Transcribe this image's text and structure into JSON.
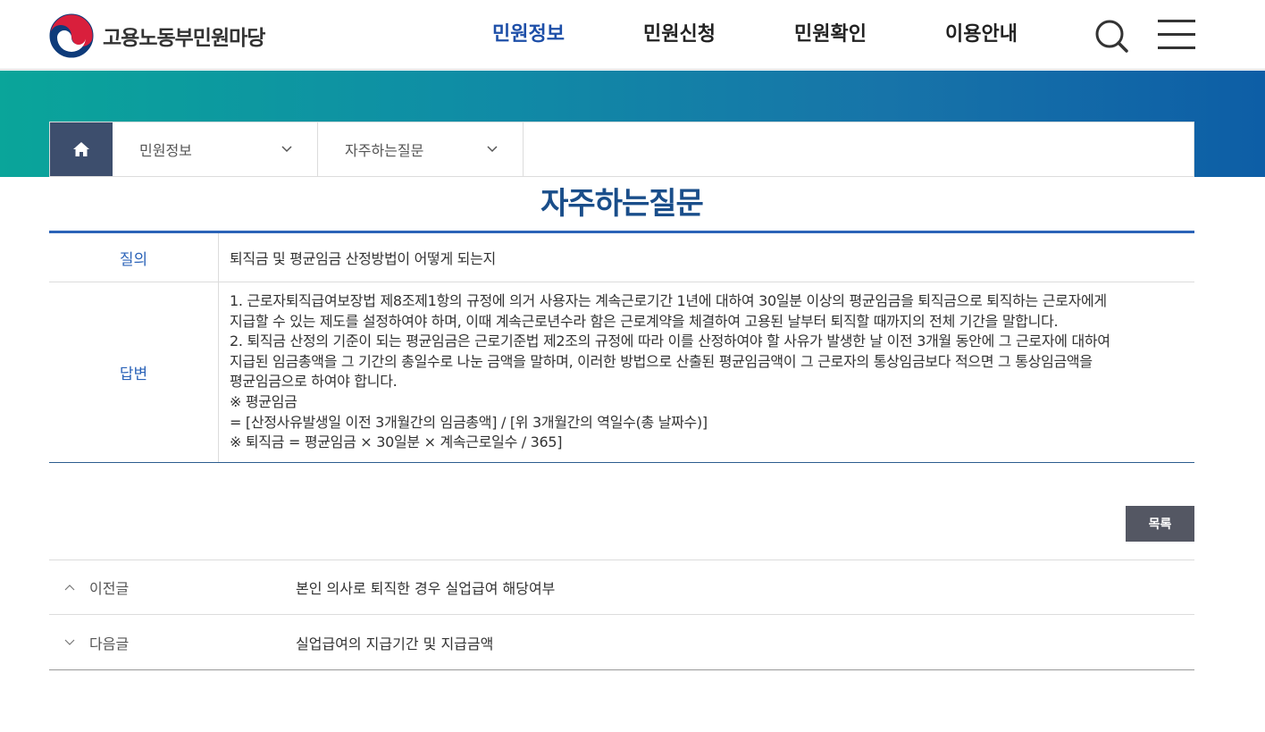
{
  "header": {
    "logo_text": "고용노동부민원마당",
    "nav": [
      {
        "label": "민원정보",
        "active": true
      },
      {
        "label": "민원신청",
        "active": false
      },
      {
        "label": "민원확인",
        "active": false
      },
      {
        "label": "이용안내",
        "active": false
      }
    ],
    "icons": {
      "search": "search-icon",
      "menu": "hamburger-menu-icon"
    },
    "active_color": "#1e4fa8"
  },
  "breadcrumb": {
    "home_icon": "home-icon",
    "level1": "민원정보",
    "level2": "자주하는질문"
  },
  "page_title": "자주하는질문",
  "qa": {
    "question_label": "질의",
    "question": "퇴직금 및 평균임금 산정방법이 어떻게 되는지",
    "answer_label": "답변",
    "answer_lines": [
      "1. 근로자퇴직급여보장법 제8조제1항의 규정에 의거 사용자는 계속근로기간 1년에 대하여 30일분 이상의 평균임금을 퇴직금으로 퇴직하는 근로자에게",
      "지급할 수 있는 제도를 설정하여야 하며, 이때 계속근로년수라 함은 근로계약을 체결하여 고용된 날부터 퇴직할 때까지의 전체 기간을 말합니다.",
      "2. 퇴직금 산정의 기준이 되는 평균임금은 근로기준법 제2조의 규정에 따라 이를 산정하여야 할 사유가 발생한 날 이전 3개월 동안에 그 근로자에 대하여",
      "지급된 임금총액을 그 기간의 총일수로 나눈 금액을 말하며, 이러한 방법으로 산출된 평균임금액이 그 근로자의 통상임금보다 적으면 그 통상임금액을",
      "평균임금으로 하여야 합니다.",
      "※ 평균임금",
      "= [산정사유발생일 이전 3개월간의 임금총액] / [위 3개월간의 역일수(총 날짜수)]",
      "※ 퇴직금 = 평균임금 × 30일분 × 계속근로일수 / 365]"
    ]
  },
  "list_button": "목록",
  "prev": {
    "label": "이전글",
    "title": "본인 의사로 퇴직한 경우 실업급여 해당여부"
  },
  "next": {
    "label": "다음글",
    "title": "실업급여의 지급기간 및 지급금액"
  }
}
